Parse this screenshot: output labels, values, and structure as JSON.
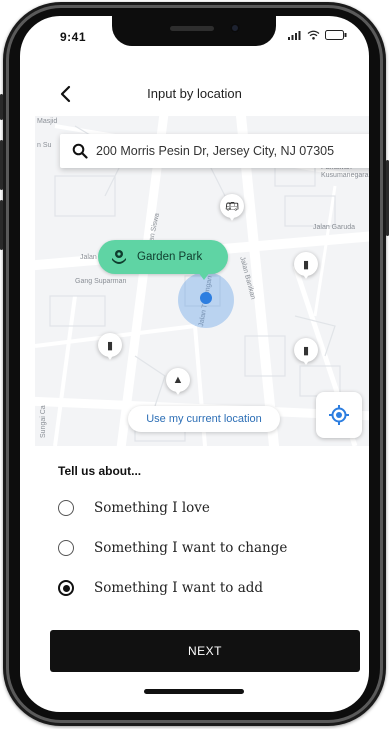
{
  "status_bar": {
    "time": "9:41"
  },
  "header": {
    "title": "Input by location"
  },
  "search": {
    "value": "200 Morris Pesin Dr, Jersey City, NJ 07305"
  },
  "map": {
    "labels": [
      "Masjid",
      "n Su",
      "Jalan Garuda",
      "Jalan",
      "Gang Suparman",
      "Jalan Tunjungan",
      "Jalan Banikan",
      "man Siswa",
      "Sungai Ca",
      "Jalan Bantuan Pahlawan Kusumanegara"
    ],
    "place": {
      "name": "Garden Park",
      "icon": "flower-icon",
      "color": "#5fd4a4"
    },
    "current_location_label": "Use my current location",
    "accent": "#2d7ee0"
  },
  "form": {
    "heading": "Tell us about...",
    "options": [
      {
        "label": "Something I love",
        "selected": false
      },
      {
        "label": "Something I want to change",
        "selected": false
      },
      {
        "label": "Something I want to add",
        "selected": true
      }
    ]
  },
  "footer": {
    "next_label": "NEXT"
  }
}
